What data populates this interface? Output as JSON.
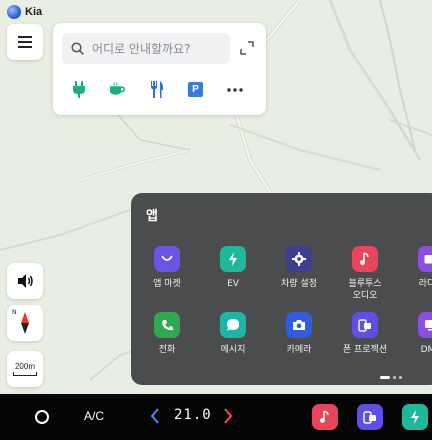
{
  "brand": {
    "name": "Kia"
  },
  "search": {
    "placeholder": "어디로 안내할까요?"
  },
  "categories": [
    "ev-charger-icon",
    "coffee-icon",
    "restaurant-icon",
    "parking-icon",
    "more-icon"
  ],
  "parking_label": "P",
  "map": {
    "scale_label": "200m",
    "compass_label": "N"
  },
  "apps": {
    "title": "앱",
    "items": [
      {
        "label": "앱 마켓",
        "icon": "shopping-bag-icon",
        "color": "#6a55e8"
      },
      {
        "label": "EV",
        "icon": "lightning-icon",
        "color": "#20b89a"
      },
      {
        "label": "차량 설정",
        "icon": "gear-icon",
        "color": "#3b3f8f"
      },
      {
        "label": "블루투스\n오디오",
        "icon": "bluetooth-audio-icon",
        "color": "#e8445a"
      },
      {
        "label": "라디오",
        "icon": "radio-icon",
        "color": "#8b4fe0"
      },
      {
        "label": "전화",
        "icon": "phone-icon",
        "color": "#2fa84f"
      },
      {
        "label": "메시지",
        "icon": "message-icon",
        "color": "#1fb5a6"
      },
      {
        "label": "카메라",
        "icon": "camera-icon",
        "color": "#2f5de0"
      },
      {
        "label": "폰 프로젝션",
        "icon": "phone-projection-icon",
        "color": "#5d4fe8"
      },
      {
        "label": "DMB",
        "icon": "dmb-icon",
        "color": "#8b4fe0"
      }
    ]
  },
  "dock": {
    "ac_label": "A/C",
    "temperature": "21.0",
    "colors": {
      "left_arrow": "#3f8bff",
      "right_arrow": "#ff4b3a"
    },
    "shortcuts": [
      {
        "icon": "bluetooth-audio-icon",
        "color": "#e8445a"
      },
      {
        "icon": "phone-projection-icon",
        "color": "#5d4fe8"
      },
      {
        "icon": "lightning-icon",
        "color": "#20b89a"
      }
    ]
  }
}
